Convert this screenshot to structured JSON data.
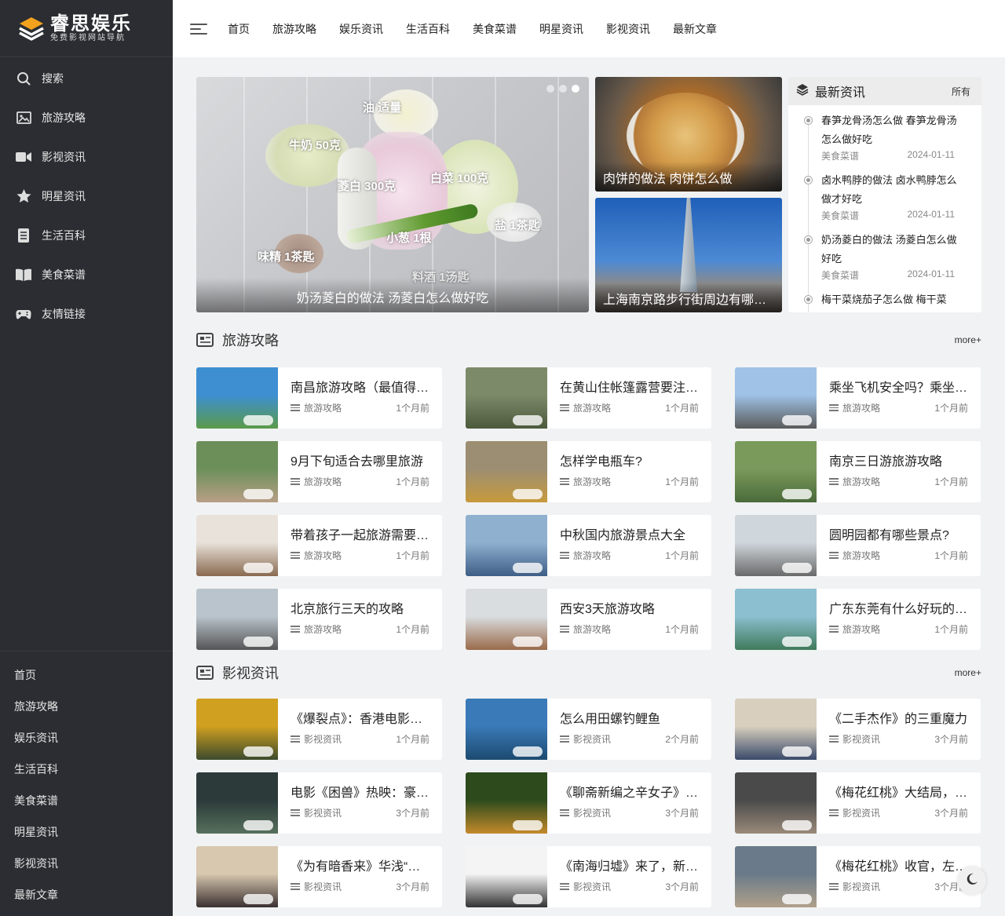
{
  "brand": {
    "title": "睿思娱乐",
    "subtitle": "免费影视网站导航"
  },
  "sidebar": {
    "items": [
      {
        "label": "搜索",
        "icon": "search-icon"
      },
      {
        "label": "旅游攻略",
        "icon": "image-icon"
      },
      {
        "label": "影视资讯",
        "icon": "video-camera-icon"
      },
      {
        "label": "明星资讯",
        "icon": "star-icon"
      },
      {
        "label": "生活百科",
        "icon": "book-icon"
      },
      {
        "label": "美食菜谱",
        "icon": "open-book-icon"
      },
      {
        "label": "友情链接",
        "icon": "gamepad-icon"
      }
    ],
    "bottom": [
      "首页",
      "旅游攻略",
      "娱乐资讯",
      "生活百科",
      "美食菜谱",
      "明星资讯",
      "影视资讯",
      "最新文章"
    ]
  },
  "topnav": [
    "首页",
    "旅游攻略",
    "娱乐资讯",
    "生活百科",
    "美食菜谱",
    "明星资讯",
    "影视资讯",
    "最新文章"
  ],
  "slider": {
    "caption": "奶汤菱白的做法 汤菱白怎么做好吃",
    "labels": [
      "油 适量",
      "牛奶 50克",
      "菱白 300克",
      "白菜 100克",
      "盐 1茶匙",
      "小葱 1根",
      "味精 1茶匙",
      "料酒 1汤匙"
    ]
  },
  "feature": [
    {
      "caption": "肉饼的做法 肉饼怎么做"
    },
    {
      "caption": "上海南京路步行街周边有哪些好玩的地方"
    }
  ],
  "newsbox": {
    "title": "最新资讯",
    "all": "所有",
    "items": [
      {
        "title": "春笋龙骨汤怎么做 春笋龙骨汤怎么做好吃",
        "cat": "美食菜谱",
        "date": "2024-01-11"
      },
      {
        "title": "卤水鸭脖的做法 卤水鸭脖怎么做才好吃",
        "cat": "美食菜谱",
        "date": "2024-01-11"
      },
      {
        "title": "奶汤菱白的做法 汤菱白怎么做好吃",
        "cat": "美食菜谱",
        "date": "2024-01-11"
      },
      {
        "title": "梅干菜烧茄子怎么做 梅干菜",
        "cat": "",
        "date": ""
      }
    ]
  },
  "sections": [
    {
      "title": "旅游攻略",
      "more": "more+",
      "cards": [
        {
          "title": "南昌旅游攻略（最值得去的景点推荐）",
          "cat": "旅游攻略",
          "time": "1个月前",
          "c1": "#3d8fd1",
          "c2": "#5a9a4a"
        },
        {
          "title": "在黄山住帐篷露营要注意什么",
          "cat": "旅游攻略",
          "time": "1个月前",
          "c1": "#7c8a6a",
          "c2": "#4c5a3c"
        },
        {
          "title": "乘坐飞机安全吗？乘坐飞机注意事项",
          "cat": "旅游攻略",
          "time": "1个月前",
          "c1": "#9fc2e6",
          "c2": "#5a5a5a"
        },
        {
          "title": "9月下旬适合去哪里旅游",
          "cat": "旅游攻略",
          "time": "1个月前",
          "c1": "#6c8f5a",
          "c2": "#b89f86"
        },
        {
          "title": "怎样学电瓶车?",
          "cat": "旅游攻略",
          "time": "1个月前",
          "c1": "#9c8e72",
          "c2": "#c79a3c"
        },
        {
          "title": "南京三日游旅游攻略",
          "cat": "旅游攻略",
          "time": "1个月前",
          "c1": "#7a9a5c",
          "c2": "#4a6a3a"
        },
        {
          "title": "带着孩子一起旅游需要注意什么",
          "cat": "旅游攻略",
          "time": "1个月前",
          "c1": "#e8e2da",
          "c2": "#8a6a50"
        },
        {
          "title": "中秋国内旅游景点大全",
          "cat": "旅游攻略",
          "time": "1个月前",
          "c1": "#8fb0cf",
          "c2": "#3e5e86"
        },
        {
          "title": "圆明园都有哪些景点?",
          "cat": "旅游攻略",
          "time": "1个月前",
          "c1": "#cfd6dc",
          "c2": "#6a6a6a"
        },
        {
          "title": "北京旅行三天的攻略",
          "cat": "旅游攻略",
          "time": "1个月前",
          "c1": "#b9c4cc",
          "c2": "#555"
        },
        {
          "title": "西安3天旅游攻略",
          "cat": "旅游攻略",
          "time": "1个月前",
          "c1": "#d9dde0",
          "c2": "#9a6a4a"
        },
        {
          "title": "广东东莞有什么好玩的地方",
          "cat": "旅游攻略",
          "time": "1个月前",
          "c1": "#8cbfd0",
          "c2": "#3f7a5a"
        }
      ]
    },
    {
      "title": "影视资讯",
      "more": "more+",
      "cards": [
        {
          "title": "《爆裂点》：香港电影新作",
          "cat": "影视资讯",
          "time": "1个月前",
          "c1": "#d0a020",
          "c2": "#3c4a2c"
        },
        {
          "title": "怎么用田螺钓鲤鱼",
          "cat": "影视资讯",
          "time": "2个月前",
          "c1": "#3a7ab8",
          "c2": "#1c4a70"
        },
        {
          "title": "《二手杰作》的三重魔力",
          "cat": "影视资讯",
          "time": "3个月前",
          "c1": "#d9cfbf",
          "c2": "#3a4a6a"
        },
        {
          "title": "电影《困兽》热映：豪华阵容",
          "cat": "影视资讯",
          "time": "3个月前",
          "c1": "#2c3a3a",
          "c2": "#56705c"
        },
        {
          "title": "《聊斋新编之辛女子》定档",
          "cat": "影视资讯",
          "time": "3个月前",
          "c1": "#2c4a1c",
          "c2": "#c48a2a"
        },
        {
          "title": "《梅花红桃》大结局，揭秘",
          "cat": "影视资讯",
          "time": "3个月前",
          "c1": "#4a4a4a",
          "c2": "#9a8a7a"
        },
        {
          "title": "《为有暗香来》华浅“黑化”",
          "cat": "影视资讯",
          "time": "3个月前",
          "c1": "#d8c8b0",
          "c2": "#3a3030"
        },
        {
          "title": "《南海归墟》来了，新版口碑",
          "cat": "影视资讯",
          "time": "3个月前",
          "c1": "#f4f4f4",
          "c2": "#333"
        },
        {
          "title": "《梅花红桃》收官，左晗与",
          "cat": "影视资讯",
          "time": "3个月前",
          "c1": "#6a7a8a",
          "c2": "#b0a08a"
        }
      ]
    }
  ]
}
